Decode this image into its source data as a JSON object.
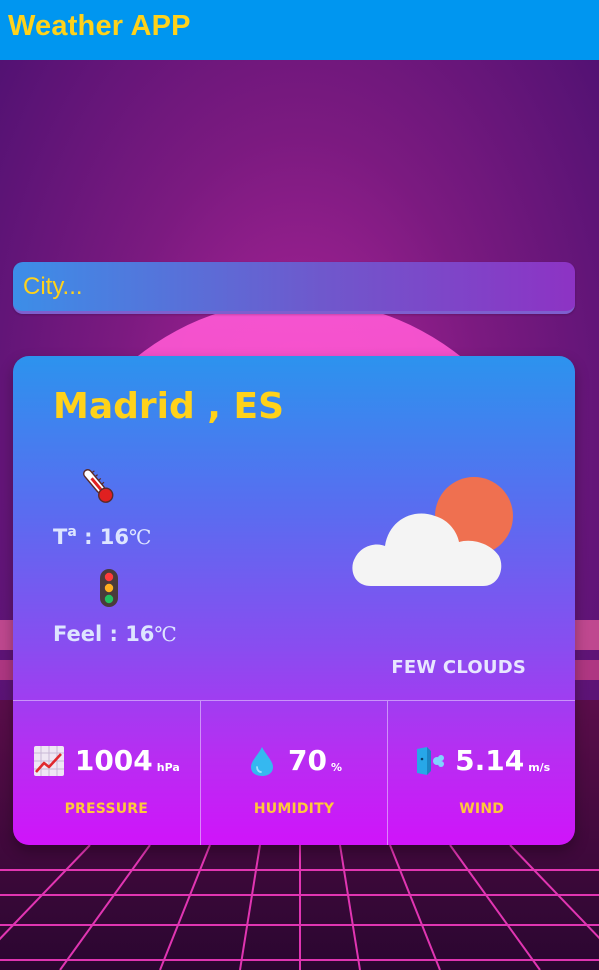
{
  "header": {
    "title": "Weather APP"
  },
  "search": {
    "placeholder": "City...",
    "value": ""
  },
  "weather": {
    "city": "Madrid , ES",
    "temp_label": "T",
    "temp_sup": "a",
    "temp_value": " : 16",
    "temp_unit": "℃",
    "feel_label": "Feel : 16",
    "feel_unit": "℃",
    "description": "FEW CLOUDS",
    "condition_icon": "few-clouds-icon"
  },
  "stats": [
    {
      "icon": "pressure-chart-icon",
      "value": "1004",
      "unit": "hPa",
      "label": "PRESSURE"
    },
    {
      "icon": "water-drop-icon",
      "value": "70",
      "unit": "%",
      "label": "HUMIDITY"
    },
    {
      "icon": "wind-icon",
      "value": "5.14",
      "unit": "m/s",
      "label": "WIND"
    }
  ],
  "colors": {
    "header_bg": "#0096f0",
    "accent_yellow": "#ffd21a",
    "label_orange": "#ffc83a"
  }
}
